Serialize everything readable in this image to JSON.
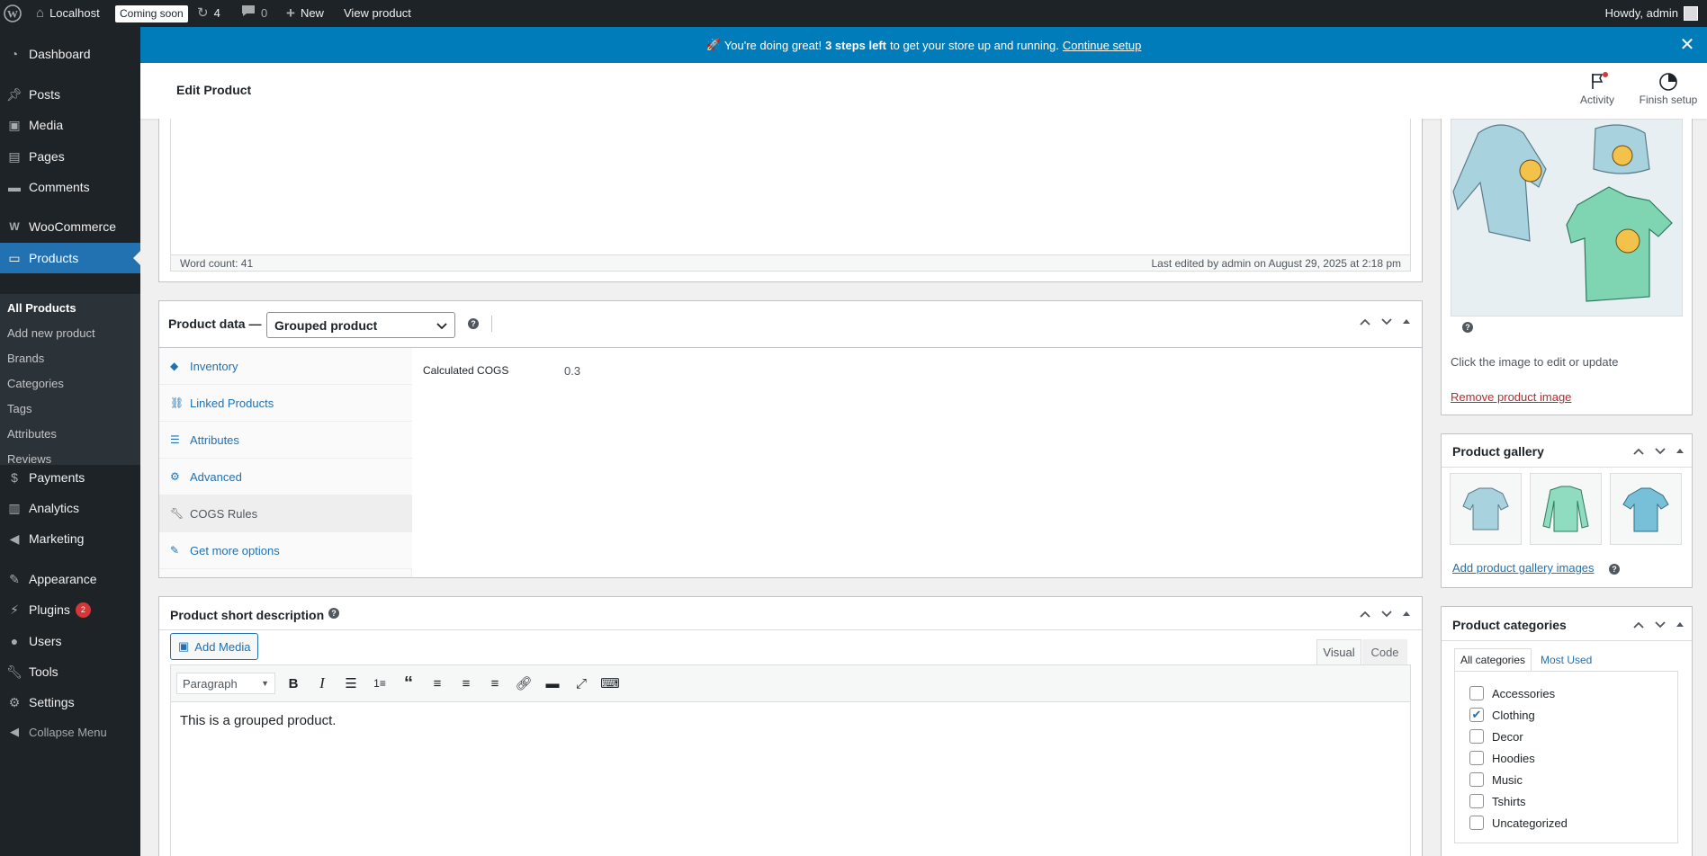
{
  "adminbar": {
    "site": "Localhost",
    "coming_soon": "Coming soon",
    "updates": "4",
    "comments": "0",
    "new": "New",
    "view_product": "View product",
    "howdy": "Howdy, admin"
  },
  "sidebar": {
    "items": [
      {
        "label": "Dashboard",
        "icon": "dashboard-icon"
      },
      {
        "label": "Posts",
        "icon": "pin-icon"
      },
      {
        "label": "Media",
        "icon": "media-icon"
      },
      {
        "label": "Pages",
        "icon": "pages-icon"
      },
      {
        "label": "Comments",
        "icon": "comment-icon"
      },
      {
        "label": "WooCommerce",
        "icon": "woo-icon"
      },
      {
        "label": "Products",
        "icon": "archive-icon"
      },
      {
        "label": "Payments",
        "icon": "dollar-icon"
      },
      {
        "label": "Analytics",
        "icon": "bar-chart-icon"
      },
      {
        "label": "Marketing",
        "icon": "megaphone-icon"
      },
      {
        "label": "Appearance",
        "icon": "brush-icon"
      },
      {
        "label": "Plugins",
        "icon": "plugin-icon",
        "badge": "2"
      },
      {
        "label": "Users",
        "icon": "users-icon"
      },
      {
        "label": "Tools",
        "icon": "wrench-icon"
      },
      {
        "label": "Settings",
        "icon": "settings-icon"
      },
      {
        "label": "Collapse Menu",
        "icon": "collapse-icon"
      }
    ],
    "submenu": [
      "All Products",
      "Add new product",
      "Brands",
      "Categories",
      "Tags",
      "Attributes",
      "Reviews"
    ]
  },
  "banner": {
    "emoji": "🚀",
    "text_before": "You're doing great!",
    "bold": "3 steps left",
    "text_after": "to get your store up and running.",
    "link": "Continue setup"
  },
  "header": {
    "title": "Edit Product",
    "activity": "Activity",
    "finish_setup": "Finish setup"
  },
  "editor_status": {
    "word_count": "Word count: 41",
    "last_edited": "Last edited by admin on August 29, 2025 at 2:18 pm"
  },
  "product_data": {
    "label": "Product data —",
    "type": "Grouped product",
    "tabs": [
      "Inventory",
      "Linked Products",
      "Attributes",
      "Advanced",
      "COGS Rules",
      "Get more options"
    ],
    "selected_tab": "COGS Rules",
    "field_label": "Calculated COGS",
    "field_value": "0.3"
  },
  "short_description": {
    "title": "Product short description",
    "add_media": "Add Media",
    "visual": "Visual",
    "code": "Code",
    "format": "Paragraph",
    "content": "This is a grouped product."
  },
  "product_image": {
    "hint": "Click the image to edit or update",
    "remove": "Remove product image"
  },
  "gallery": {
    "title": "Product gallery",
    "add": "Add product gallery images"
  },
  "categories": {
    "title": "Product categories",
    "tab_all": "All categories",
    "tab_most": "Most Used",
    "items": [
      {
        "label": "Accessories",
        "checked": false
      },
      {
        "label": "Clothing",
        "checked": true
      },
      {
        "label": "Decor",
        "checked": false
      },
      {
        "label": "Hoodies",
        "checked": false
      },
      {
        "label": "Music",
        "checked": false
      },
      {
        "label": "Tshirts",
        "checked": false
      },
      {
        "label": "Uncategorized",
        "checked": false
      }
    ]
  }
}
